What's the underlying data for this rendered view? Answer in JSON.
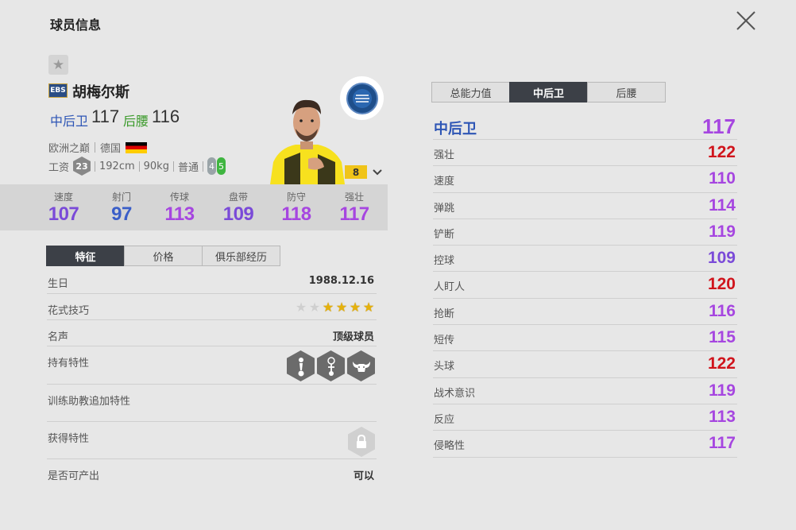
{
  "header": {
    "title": "球员信息"
  },
  "player": {
    "season_badge": "EBS",
    "name": "胡梅尔斯",
    "positions": [
      {
        "label": "中后卫",
        "value": "117"
      },
      {
        "label": "后腰",
        "value": "116"
      }
    ],
    "league": "欧洲之巅",
    "nation": "德国",
    "salary_label": "工资",
    "salary": "23",
    "height": "192cm",
    "weight": "90kg",
    "body_type": "普通",
    "weak_foot": "4",
    "strong_foot": "5",
    "level": "8"
  },
  "stats": [
    {
      "label": "速度",
      "value": "107",
      "color": "#7a4ad8"
    },
    {
      "label": "射门",
      "value": "97",
      "color": "#3a5ec8"
    },
    {
      "label": "传球",
      "value": "113",
      "color": "#a646e0"
    },
    {
      "label": "盘带",
      "value": "109",
      "color": "#7a4ad8"
    },
    {
      "label": "防守",
      "value": "118",
      "color": "#a646e0"
    },
    {
      "label": "强壮",
      "value": "117",
      "color": "#a646e0"
    }
  ],
  "left_tabs": [
    "特征",
    "价格",
    "俱乐部经历"
  ],
  "features": {
    "birthday_label": "生日",
    "birthday": "1988.12.16",
    "skill_label": "花式技巧",
    "skill_stars": 4,
    "skill_stars_max": 6,
    "reputation_label": "名声",
    "reputation": "顶级球员",
    "traits_label": "持有特性",
    "traits_icons": [
      "header-trait-icon",
      "long-throw-trait-icon",
      "bull-trait-icon"
    ],
    "coach_traits_label": "训练助教追加特性",
    "earned_traits_label": "获得特性",
    "producible_label": "是否可产出",
    "producible": "可以"
  },
  "right_tabs": [
    "总能力值",
    "中后卫",
    "后腰"
  ],
  "position_rating": {
    "label": "中后卫",
    "value": "117",
    "color": "#a646e0"
  },
  "attributes": [
    {
      "label": "强壮",
      "value": "122",
      "color": "#d0141c"
    },
    {
      "label": "速度",
      "value": "110",
      "color": "#a646e0"
    },
    {
      "label": "弹跳",
      "value": "114",
      "color": "#a646e0"
    },
    {
      "label": "铲断",
      "value": "119",
      "color": "#a646e0"
    },
    {
      "label": "控球",
      "value": "109",
      "color": "#7a4ad8"
    },
    {
      "label": "人盯人",
      "value": "120",
      "color": "#d0141c"
    },
    {
      "label": "抢断",
      "value": "116",
      "color": "#a646e0"
    },
    {
      "label": "短传",
      "value": "115",
      "color": "#a646e0"
    },
    {
      "label": "头球",
      "value": "122",
      "color": "#d0141c"
    },
    {
      "label": "战术意识",
      "value": "119",
      "color": "#a646e0"
    },
    {
      "label": "反应",
      "value": "113",
      "color": "#a646e0"
    },
    {
      "label": "侵略性",
      "value": "117",
      "color": "#a646e0"
    }
  ]
}
